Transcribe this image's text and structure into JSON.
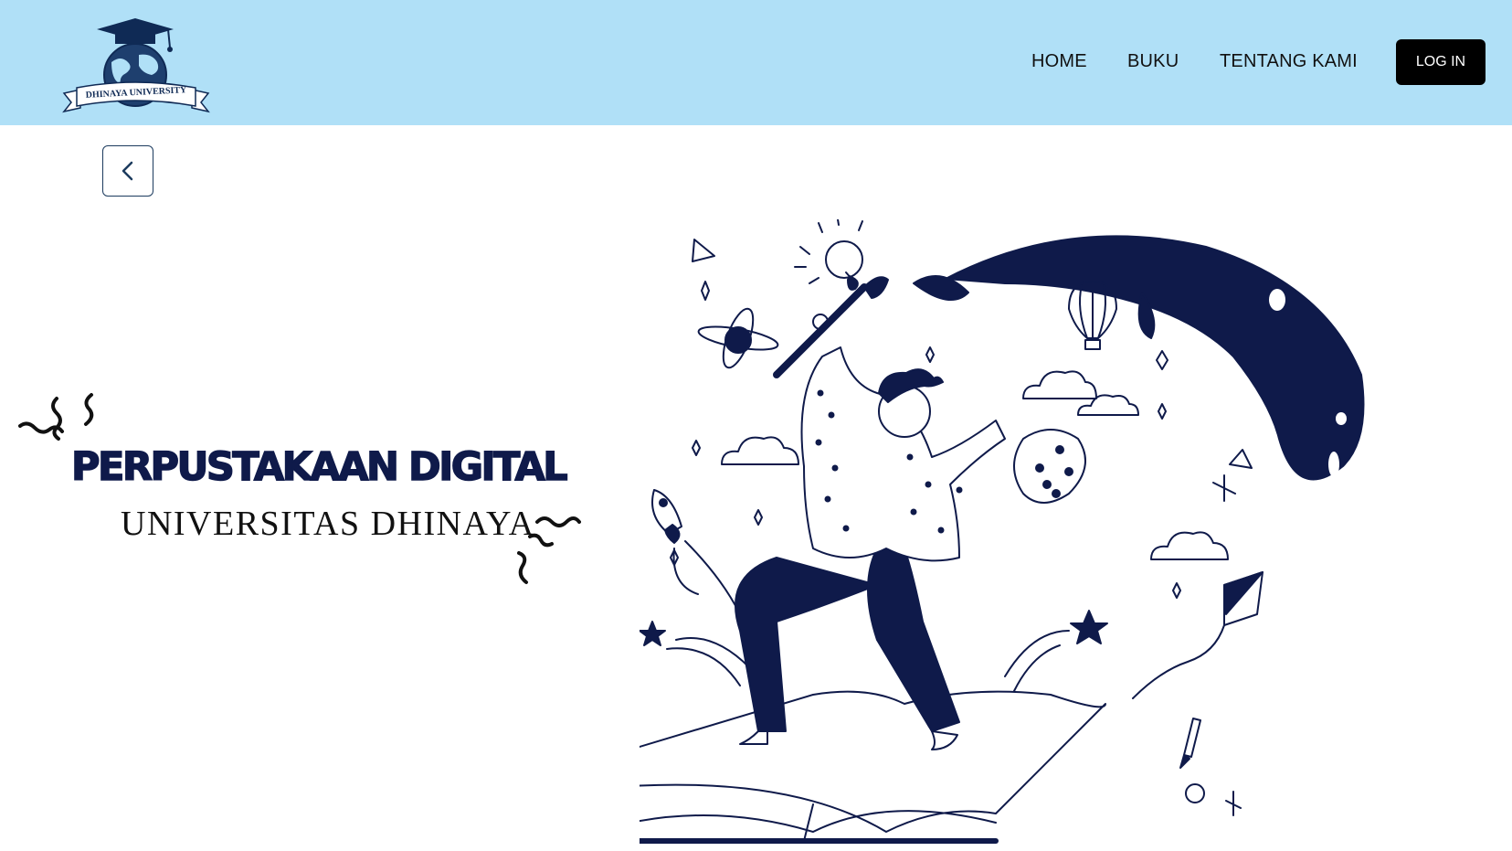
{
  "header": {
    "logo_text": "DHINAYA UNIVERSITY",
    "background_color": "#b0e0f7"
  },
  "nav": {
    "items": [
      {
        "label": "HOME"
      },
      {
        "label": "BUKU"
      },
      {
        "label": "TENTANG KAMI"
      }
    ],
    "login_label": "LOG IN"
  },
  "back_button": {
    "icon": "chevron-left-icon"
  },
  "hero": {
    "title": "PERPUSTAKAAN DIGITAL",
    "subtitle": "UNIVERSITAS DHINAYA"
  },
  "colors": {
    "navy": "#0f1a4a",
    "header": "#b0e0f7",
    "button": "#000000"
  }
}
